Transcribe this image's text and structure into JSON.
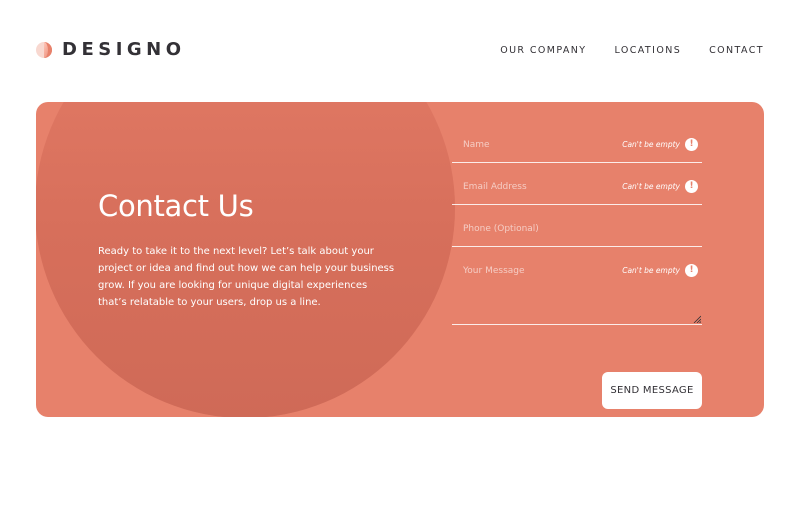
{
  "brand": {
    "name": "DESIGNO",
    "logo_icon": "half-circle-logo-icon",
    "colors": {
      "accent": "#e7816b",
      "logo_light": "#ffad9b",
      "logo_dark": "#e7816b",
      "text_dark": "#333136"
    }
  },
  "nav": {
    "items": [
      {
        "label": "OUR COMPANY"
      },
      {
        "label": "LOCATIONS"
      },
      {
        "label": "CONTACT"
      }
    ]
  },
  "contact": {
    "title": "Contact Us",
    "description": "Ready to take it to the next level? Let’s talk about your project or idea and find out how we can help your business grow. If you are looking for unique digital experiences that’s relatable to your users, drop us a line."
  },
  "form": {
    "name": {
      "placeholder": "Name",
      "value": "",
      "error": "Can't be empty"
    },
    "email": {
      "placeholder": "Email Address",
      "value": "",
      "error": "Can't be empty"
    },
    "phone": {
      "placeholder": "Phone (Optional)",
      "value": ""
    },
    "message": {
      "placeholder": "Your Message",
      "value": "",
      "error": "Can't be empty"
    },
    "error_icon": "exclamation-icon",
    "submit_label": "SEND MESSAGE"
  }
}
